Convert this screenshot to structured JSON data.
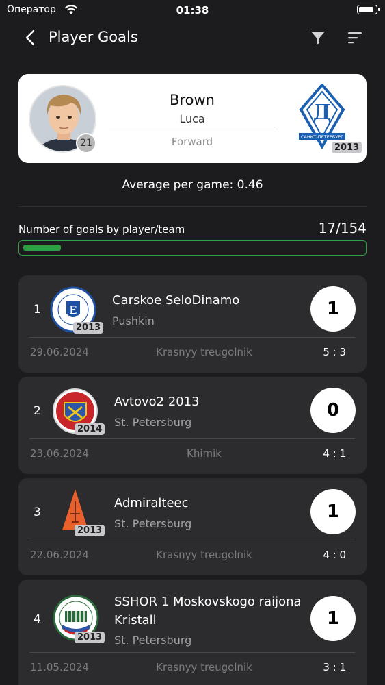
{
  "status": {
    "carrier": "Оператор",
    "time": "01:38",
    "battery_level": 0.9
  },
  "nav": {
    "title": "Player Goals"
  },
  "player": {
    "last_name": "Brown",
    "first_name": "Luca",
    "number": "21",
    "position": "Forward",
    "team_year": "2013",
    "team_logo_text": "САНКТ-ПЕТЕРБУРГ"
  },
  "stats": {
    "average": "Average per game: 0.46",
    "goals_label": "Number of goals by player/team",
    "goals_value": "17/154",
    "goals_ratio": 0.11
  },
  "games": [
    {
      "num": "1",
      "club": "Carskoe SeloDinamo",
      "city": "Pushkin",
      "goals": "1",
      "date": "29.06.2024",
      "venue": "Krasnyy treugolnik",
      "score": "5 : 3",
      "year": "2013"
    },
    {
      "num": "2",
      "club": "Avtovo2 2013",
      "city": "St. Petersburg",
      "goals": "0",
      "date": "23.06.2024",
      "venue": "Khimik",
      "score": "4 : 1",
      "year": "2014"
    },
    {
      "num": "3",
      "club": "Admiralteec",
      "city": "St. Petersburg",
      "goals": "1",
      "date": "22.06.2024",
      "venue": "Krasnyy treugolnik",
      "score": "4 : 0",
      "year": "2013"
    },
    {
      "num": "4",
      "club": "SSHOR 1 Moskovskogo raijona Kristall",
      "city": "St. Petersburg",
      "goals": "1",
      "date": "11.05.2024",
      "venue": "Krasnyy treugolnik",
      "score": "3 : 1",
      "year": "2013"
    }
  ],
  "colors": {
    "background": "#1c1c1e",
    "card": "#2c2c2e",
    "accent": "#2ea043"
  }
}
